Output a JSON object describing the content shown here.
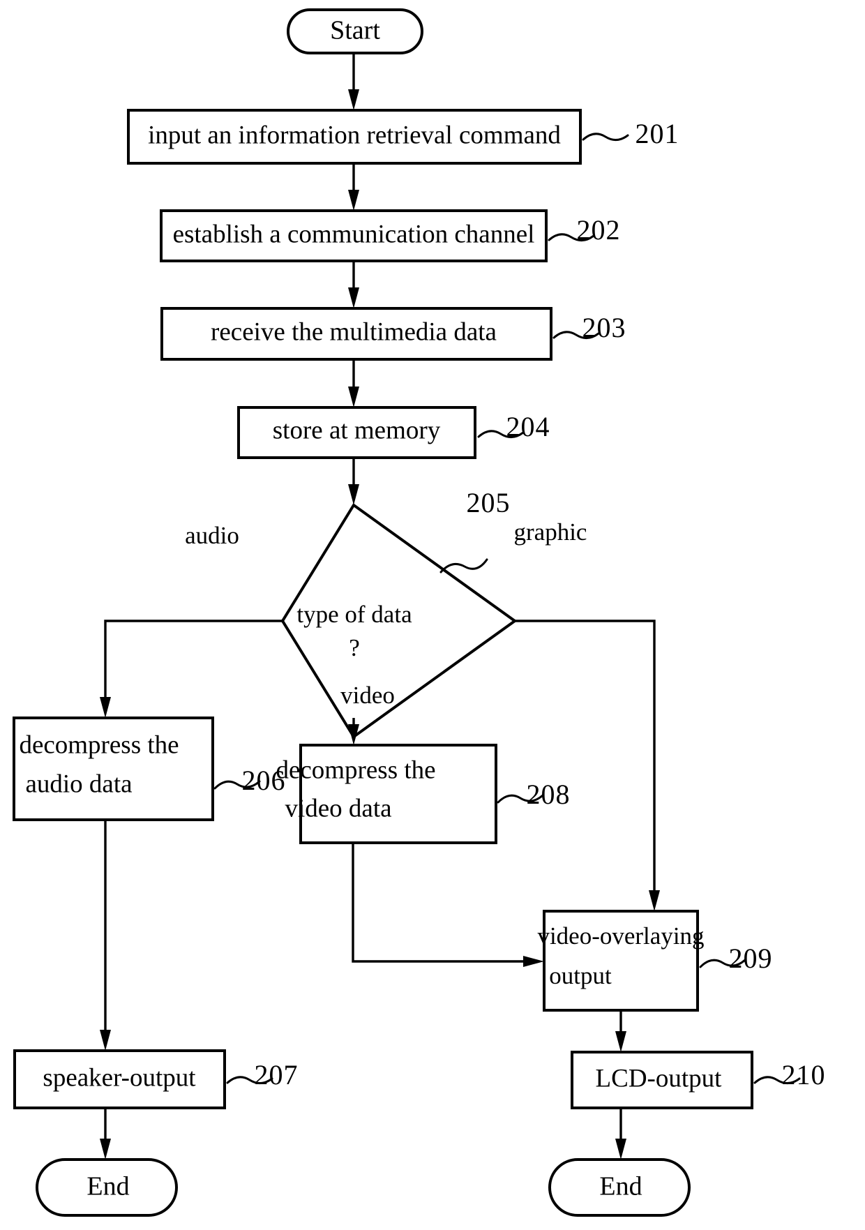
{
  "figure": {
    "type": "flowchart",
    "title": "Multimedia data retrieval and output process"
  },
  "nodes": {
    "start": {
      "label": "Start",
      "shape": "terminator"
    },
    "n201": {
      "label": "input an information retrieval command",
      "ref": "201",
      "shape": "process"
    },
    "n202": {
      "label": "establish a communication channel",
      "ref": "202",
      "shape": "process"
    },
    "n203": {
      "label": "receive the multimedia data",
      "ref": "203",
      "shape": "process"
    },
    "n204": {
      "label": "store at memory",
      "ref": "204",
      "shape": "process"
    },
    "n205": {
      "label_line1": "type of data",
      "label_line2": "?",
      "ref": "205",
      "shape": "decision"
    },
    "n206": {
      "label_line1": "decompress the",
      "label_line2": "audio data",
      "ref": "206",
      "shape": "process"
    },
    "n208": {
      "label_line1": "decompress the",
      "label_line2": "video data",
      "ref": "208",
      "shape": "process"
    },
    "n209": {
      "label_line1": "video-overlaying",
      "label_line2": "output",
      "ref": "209",
      "shape": "process"
    },
    "n207": {
      "label": "speaker-output",
      "ref": "207",
      "shape": "process"
    },
    "n210": {
      "label": "LCD-output",
      "ref": "210",
      "shape": "process"
    },
    "end_left": {
      "label": "End",
      "shape": "terminator"
    },
    "end_right": {
      "label": "End",
      "shape": "terminator"
    }
  },
  "branch_labels": {
    "audio": "audio",
    "graphic": "graphic",
    "video": "video"
  },
  "colors": {
    "stroke": "#000000",
    "fill": "#ffffff",
    "background": "#ffffff"
  }
}
